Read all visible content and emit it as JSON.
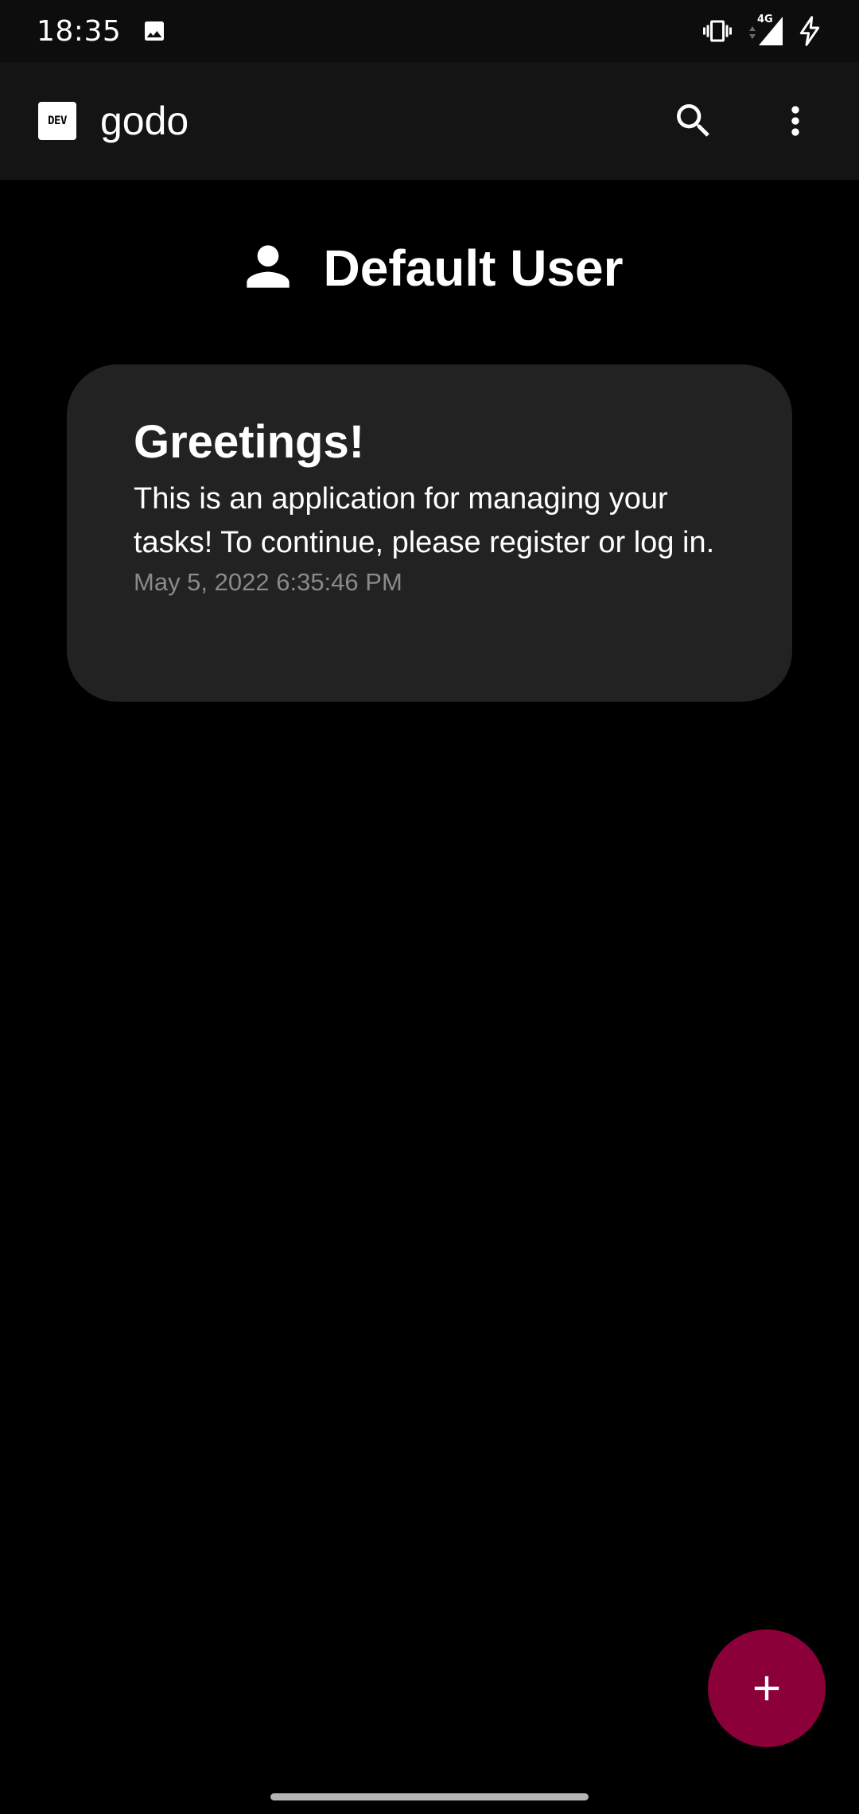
{
  "status_bar": {
    "time": "18:35",
    "network_label": "4G",
    "icons": [
      "image-icon",
      "vibrate-icon",
      "signal-icon",
      "charging-icon"
    ]
  },
  "app_bar": {
    "badge_label": "DEV",
    "title": "godo",
    "icons": [
      "search-icon",
      "more-vert-icon"
    ]
  },
  "user": {
    "name": "Default User",
    "icon": "person-icon"
  },
  "card": {
    "title": "Greetings!",
    "body": "This is an application for managing your tasks! To continue, please register or log in.",
    "date": "May 5, 2022 6:35:46 PM"
  },
  "fab": {
    "icon": "plus-icon",
    "color": "#8b0038"
  },
  "colors": {
    "background": "#000000",
    "app_bar": "#141414",
    "card": "#222222",
    "accent": "#8b0038",
    "muted_text": "#8a8a8a"
  }
}
